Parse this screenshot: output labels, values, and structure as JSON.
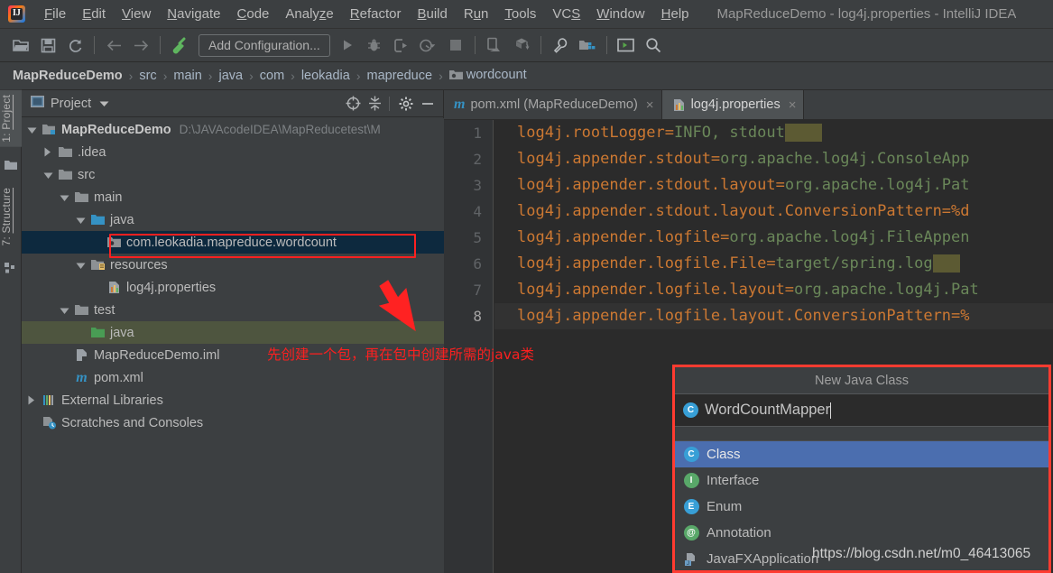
{
  "window": {
    "title": "MapReduceDemo - log4j.properties - IntelliJ IDEA",
    "logo_name": "intellij-idea-logo"
  },
  "menu": [
    {
      "label": "File",
      "mnemonic": "F"
    },
    {
      "label": "Edit",
      "mnemonic": "E"
    },
    {
      "label": "View",
      "mnemonic": "V"
    },
    {
      "label": "Navigate",
      "mnemonic": "N"
    },
    {
      "label": "Code",
      "mnemonic": "C"
    },
    {
      "label": "Analyze",
      "mnemonic": "z"
    },
    {
      "label": "Refactor",
      "mnemonic": "R"
    },
    {
      "label": "Build",
      "mnemonic": "B"
    },
    {
      "label": "Run",
      "mnemonic": "u"
    },
    {
      "label": "Tools",
      "mnemonic": "T"
    },
    {
      "label": "VCS",
      "mnemonic": "S"
    },
    {
      "label": "Window",
      "mnemonic": "W"
    },
    {
      "label": "Help",
      "mnemonic": "H"
    }
  ],
  "toolbar": {
    "add_configuration_label": "Add Configuration...",
    "icons": [
      "open-folder-icon",
      "save-all-icon",
      "sync-refresh-icon",
      "back-arrow-icon",
      "forward-arrow-icon",
      "build-hammer-icon",
      "run-icon",
      "debug-icon",
      "run-with-coverage-icon",
      "profiler-dropdown-icon",
      "stop-icon",
      "device-manager-icon",
      "sdk-download-icon",
      "settings-wrench-icon",
      "project-structure-icon",
      "terminal-icon",
      "search-everywhere-icon"
    ]
  },
  "breadcrumb": {
    "separator": "›",
    "items": [
      "MapReduceDemo",
      "src",
      "main",
      "java",
      "com",
      "leokadia",
      "mapreduce",
      "wordcount"
    ]
  },
  "left_toolwindows": [
    {
      "label_prefix": "1: ",
      "label": "Project",
      "mnemonic": "P",
      "active": true,
      "icon": "project-folder-icon"
    },
    {
      "label_prefix": "7: ",
      "label": "Structure",
      "mnemonic": "S",
      "active": false,
      "icon": "structure-blocks-icon"
    }
  ],
  "project_panel": {
    "title": "Project",
    "caret_icon": "chevron-down-icon",
    "header_buttons": [
      "locate-target-icon",
      "collapse-all-icon",
      "settings-gear-icon",
      "hide-minimize-icon"
    ],
    "tree": [
      {
        "label": "MapReduceDemo",
        "sub": "D:\\JAVAcodeIDEA\\MapReducetest\\M",
        "indent": 0,
        "arrow": "down",
        "icon": "module-folder-icon",
        "bold": true,
        "state": "normal"
      },
      {
        "label": ".idea",
        "sub": "",
        "indent": 1,
        "arrow": "right",
        "icon": "folder-icon",
        "bold": false,
        "state": "normal"
      },
      {
        "label": "src",
        "sub": "",
        "indent": 1,
        "arrow": "down",
        "icon": "folder-icon",
        "bold": false,
        "state": "normal"
      },
      {
        "label": "main",
        "sub": "",
        "indent": 2,
        "arrow": "down",
        "icon": "folder-icon",
        "bold": false,
        "state": "normal"
      },
      {
        "label": "java",
        "sub": "",
        "indent": 3,
        "arrow": "down",
        "icon": "source-root-blue-icon",
        "bold": false,
        "state": "normal"
      },
      {
        "label": "com.leokadia.mapreduce.wordcount",
        "sub": "",
        "indent": 4,
        "arrow": "none",
        "icon": "package-icon",
        "bold": false,
        "state": "selected"
      },
      {
        "label": "resources",
        "sub": "",
        "indent": 3,
        "arrow": "down",
        "icon": "resources-root-icon",
        "bold": false,
        "state": "normal"
      },
      {
        "label": "log4j.properties",
        "sub": "",
        "indent": 4,
        "arrow": "none",
        "icon": "properties-file-icon",
        "bold": false,
        "state": "normal"
      },
      {
        "label": "test",
        "sub": "",
        "indent": 2,
        "arrow": "down",
        "icon": "folder-icon",
        "bold": false,
        "state": "normal"
      },
      {
        "label": "java",
        "sub": "",
        "indent": 3,
        "arrow": "none",
        "icon": "test-root-green-icon",
        "bold": false,
        "state": "green"
      },
      {
        "label": "MapReduceDemo.iml",
        "sub": "",
        "indent": 2,
        "arrow": "none",
        "icon": "iml-file-icon",
        "bold": false,
        "state": "normal"
      },
      {
        "label": "pom.xml",
        "sub": "",
        "indent": 2,
        "arrow": "none",
        "icon": "maven-file-icon",
        "bold": false,
        "state": "normal"
      },
      {
        "label": "External Libraries",
        "sub": "",
        "indent": 0,
        "arrow": "right",
        "icon": "libraries-icon",
        "bold": false,
        "state": "normal"
      },
      {
        "label": "Scratches and Consoles",
        "sub": "",
        "indent": 0,
        "arrow": "none",
        "icon": "scratches-icon",
        "bold": false,
        "state": "normal"
      }
    ]
  },
  "editor": {
    "tabs": [
      {
        "label": "pom.xml (MapReduceDemo)",
        "icon": "maven-file-icon",
        "active": false,
        "close_glyph": "×"
      },
      {
        "label": "log4j.properties",
        "icon": "properties-file-icon",
        "active": true,
        "close_glyph": "×"
      }
    ],
    "lines": [
      {
        "num": "1",
        "key": "log4j.rootLogger=",
        "val": "INFO, stdout",
        "sel": "    ",
        "current": false
      },
      {
        "num": "2",
        "key": "log4j.appender.stdout=",
        "val": "org.apache.log4j.ConsoleApp",
        "sel": "",
        "current": false
      },
      {
        "num": "3",
        "key": "log4j.appender.stdout.layout=",
        "val": "org.apache.log4j.Pat",
        "sel": "",
        "current": false
      },
      {
        "num": "4",
        "key": "log4j.appender.stdout.layout.ConversionPattern=%d",
        "val": "",
        "sel": "",
        "current": false
      },
      {
        "num": "5",
        "key": "log4j.appender.logfile=",
        "val": "org.apache.log4j.FileAppen",
        "sel": "",
        "current": false
      },
      {
        "num": "6",
        "key": "log4j.appender.logfile.File=",
        "val": "target/spring.log",
        "sel": "   ",
        "current": false
      },
      {
        "num": "7",
        "key": "log4j.appender.logfile.layout=",
        "val": "org.apache.log4j.Pat",
        "sel": "",
        "current": false
      },
      {
        "num": "8",
        "key": "log4j.appender.logfile.layout.ConversionPattern=%",
        "val": "",
        "sel": "",
        "current": true
      }
    ]
  },
  "annotations": {
    "chinese_note": "先创建一个包，再在包中创建所需的java类",
    "highlight_color": "#ff2020",
    "arrow_name": "red-pointer-arrow"
  },
  "new_java_class": {
    "title": "New Java Class",
    "input_value": "WordCountMapper",
    "input_icon": "class-c-icon",
    "options": [
      {
        "label": "Class",
        "icon": "class-c-icon",
        "glyph": "C",
        "color": "#389fd6",
        "selected": true
      },
      {
        "label": "Interface",
        "icon": "interface-i-icon",
        "glyph": "I",
        "color": "#59a869",
        "selected": false
      },
      {
        "label": "Enum",
        "icon": "enum-e-icon",
        "glyph": "E",
        "color": "#389fd6",
        "selected": false
      },
      {
        "label": "Annotation",
        "icon": "annotation-at-icon",
        "glyph": "@",
        "color": "#59a869",
        "selected": false
      },
      {
        "label": "JavaFXApplication",
        "icon": "javafx-app-icon",
        "glyph": "",
        "color": "#7ea6c4",
        "selected": false
      }
    ]
  },
  "watermark": {
    "url": "https://blog.csdn.net/m0_46413065"
  }
}
